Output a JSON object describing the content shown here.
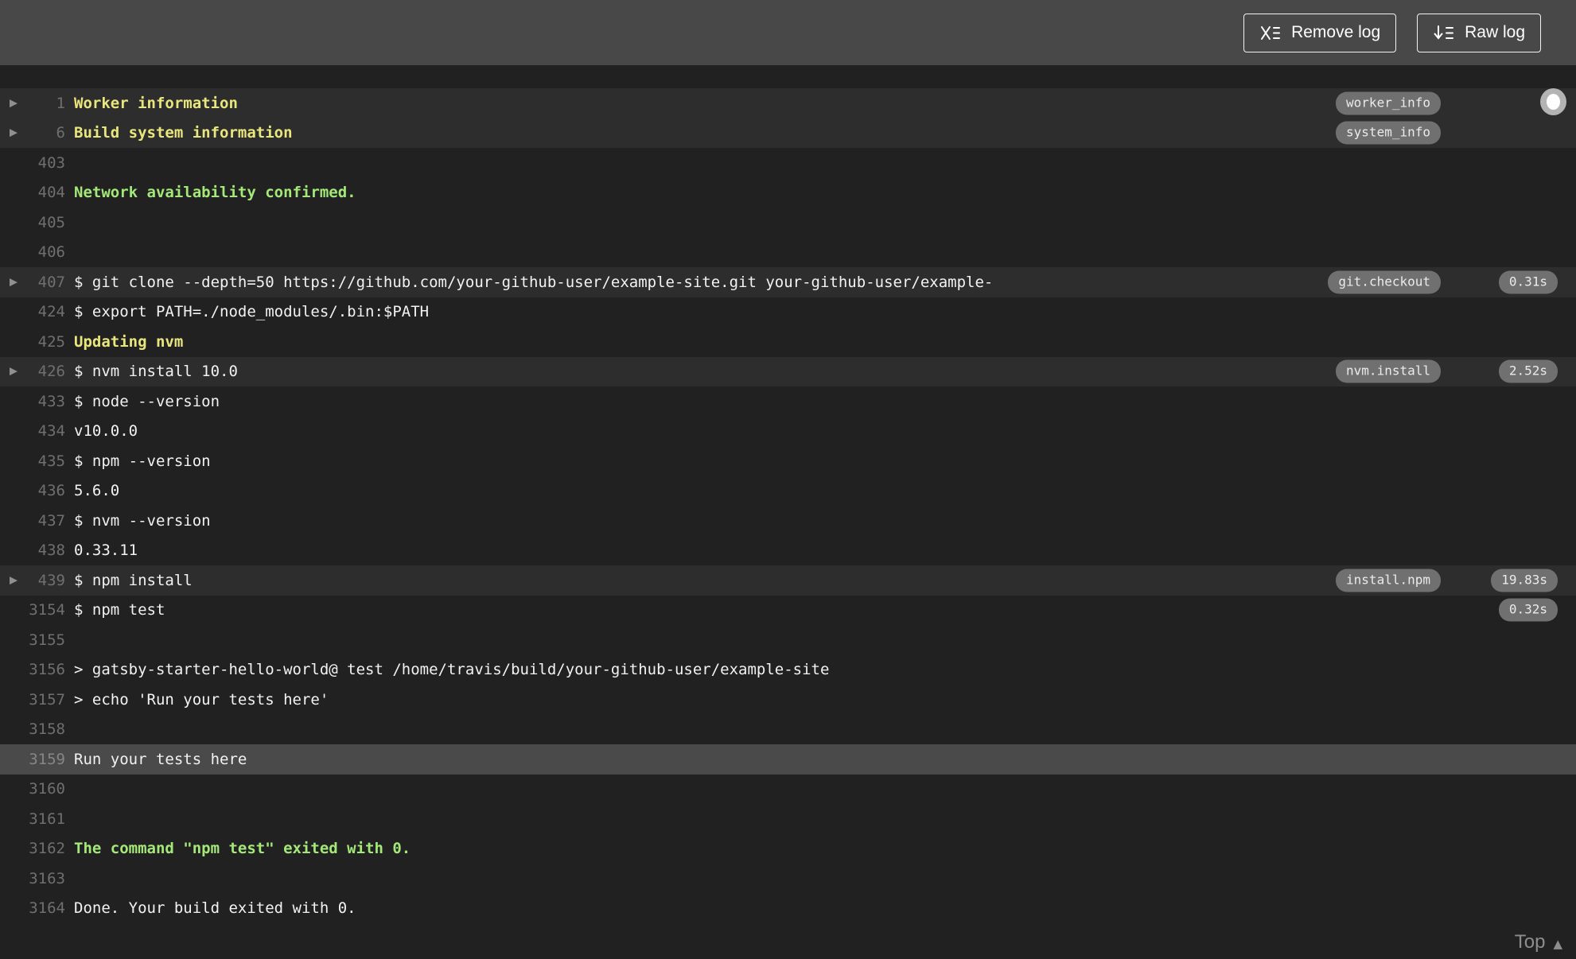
{
  "header": {
    "remove_log_label": "Remove log",
    "raw_log_label": "Raw log"
  },
  "footer": {
    "top_label": "Top"
  },
  "icons": {
    "remove_log_icon": "x-with-list-lines",
    "raw_log_icon": "down-arrow-with-list-lines",
    "fold_arrow_icon": "triangle-right",
    "top_arrow_icon": "triangle-up",
    "scroll_indicator": "circle-dot"
  },
  "colors": {
    "header_bg": "#484848",
    "log_bg": "#212121",
    "fold_row_bg": "#2d2d2d",
    "selected_row_bg": "#4a4a4a",
    "text": "#f2f2f2",
    "line_number": "#6f6f6f",
    "yellow": "#eae67e",
    "green": "#a3e878",
    "badge_bg": "#707070"
  },
  "log": {
    "lines": [
      {
        "num": "1",
        "text": "Worker information",
        "style": "yellow",
        "fold": true,
        "row": "fold",
        "badge": "worker_info"
      },
      {
        "num": "6",
        "text": "Build system information",
        "style": "yellow",
        "fold": true,
        "row": "fold",
        "badge": "system_info"
      },
      {
        "num": "403",
        "text": ""
      },
      {
        "num": "404",
        "text": "Network availability confirmed.",
        "style": "green"
      },
      {
        "num": "405",
        "text": ""
      },
      {
        "num": "406",
        "text": ""
      },
      {
        "num": "407",
        "text": "$ git clone --depth=50 https://github.com/your-github-user/example-site.git your-github-user/example-",
        "fold": true,
        "row": "fold",
        "badge": "git.checkout",
        "time": "0.31s"
      },
      {
        "num": "424",
        "text": "$ export PATH=./node_modules/.bin:$PATH"
      },
      {
        "num": "425",
        "text": "Updating nvm",
        "style": "yellow"
      },
      {
        "num": "426",
        "text": "$ nvm install 10.0",
        "fold": true,
        "row": "fold",
        "badge": "nvm.install",
        "time": "2.52s"
      },
      {
        "num": "433",
        "text": "$ node --version"
      },
      {
        "num": "434",
        "text": "v10.0.0"
      },
      {
        "num": "435",
        "text": "$ npm --version"
      },
      {
        "num": "436",
        "text": "5.6.0"
      },
      {
        "num": "437",
        "text": "$ nvm --version"
      },
      {
        "num": "438",
        "text": "0.33.11"
      },
      {
        "num": "439",
        "text": "$ npm install",
        "fold": true,
        "row": "fold",
        "badge": "install.npm",
        "time": "19.83s"
      },
      {
        "num": "3154",
        "text": "$ npm test",
        "time": "0.32s"
      },
      {
        "num": "3155",
        "text": ""
      },
      {
        "num": "3156",
        "text": "> gatsby-starter-hello-world@ test /home/travis/build/your-github-user/example-site"
      },
      {
        "num": "3157",
        "text": "> echo 'Run your tests here'"
      },
      {
        "num": "3158",
        "text": ""
      },
      {
        "num": "3159",
        "text": "Run your tests here",
        "row": "selected"
      },
      {
        "num": "3160",
        "text": ""
      },
      {
        "num": "3161",
        "text": ""
      },
      {
        "num": "3162",
        "text": "The command \"npm test\" exited with 0.",
        "style": "green"
      },
      {
        "num": "3163",
        "text": ""
      },
      {
        "num": "3164",
        "text": "Done. Your build exited with 0."
      }
    ]
  }
}
